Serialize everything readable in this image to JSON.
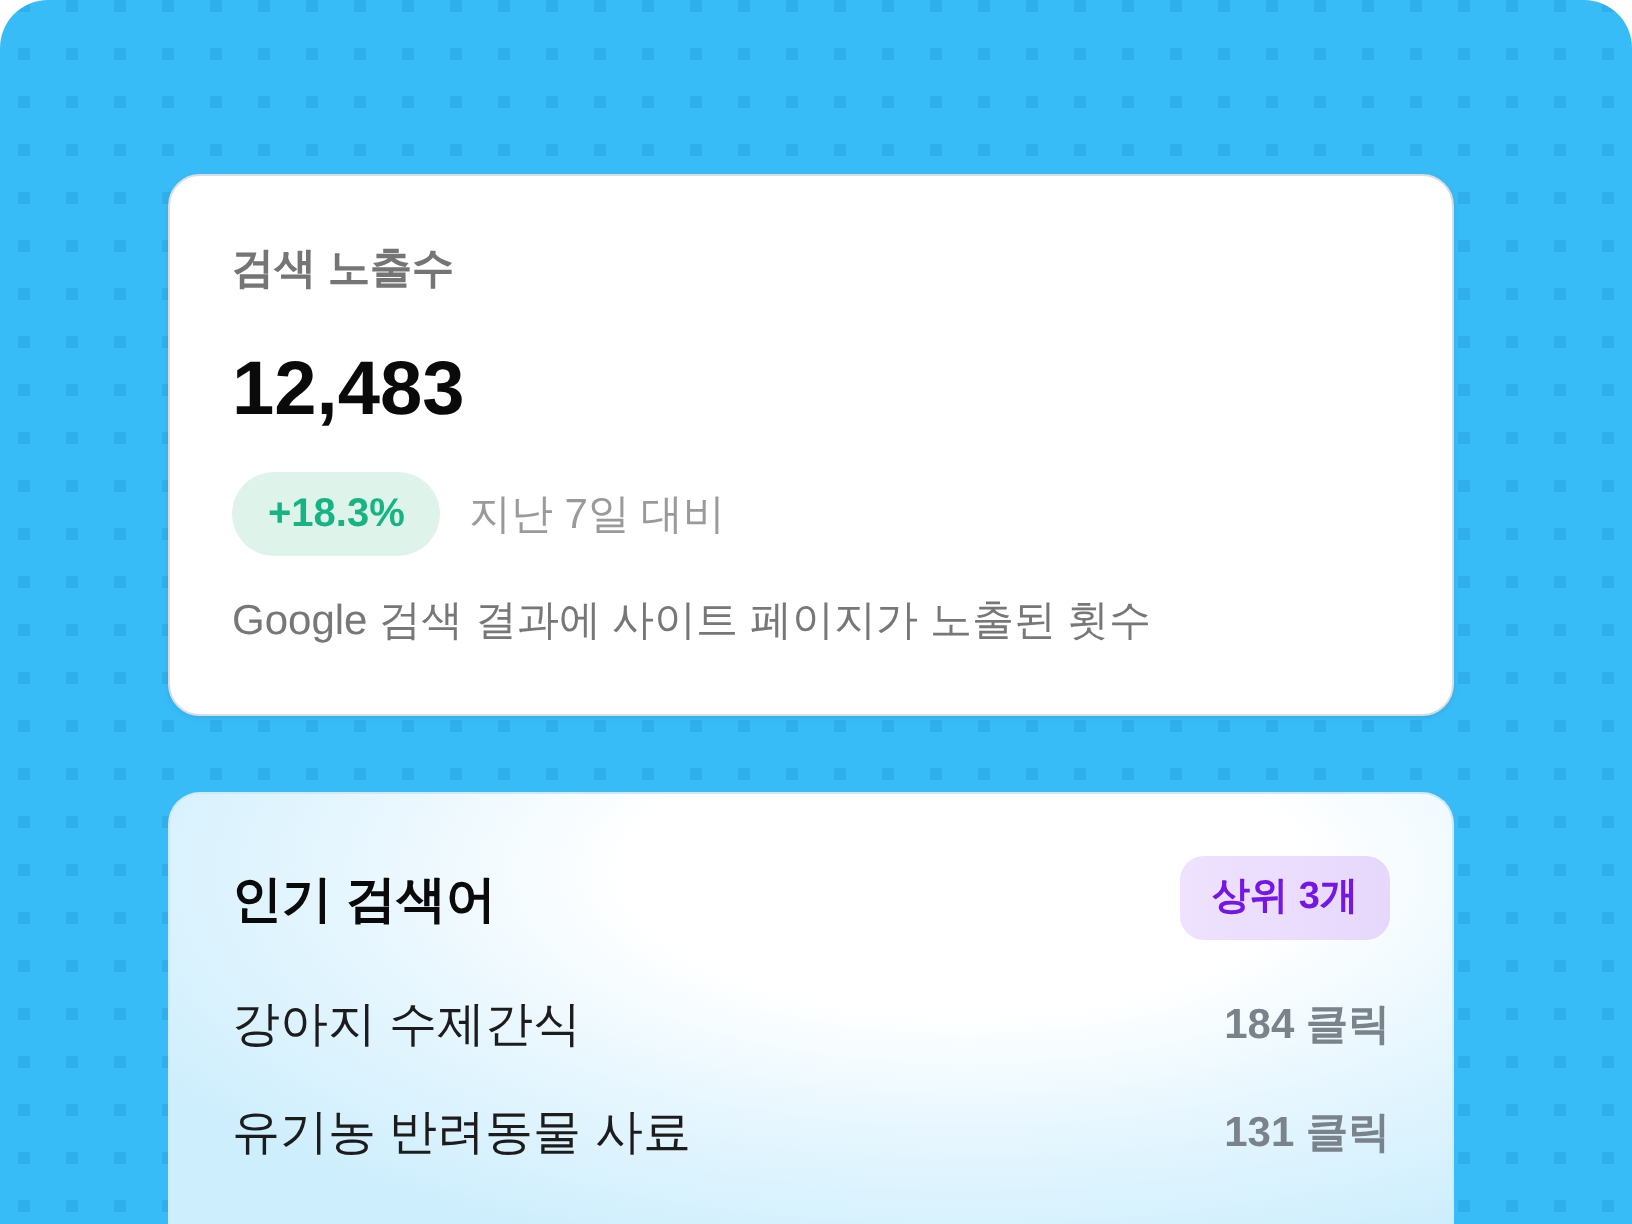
{
  "impressions_card": {
    "title": "검색 노출수",
    "value": "12,483",
    "change": {
      "text": "+18.3%",
      "positive": true
    },
    "comparison": "지난 7일 대비",
    "description": "Google 검색 결과에 사이트 페이지가 노출된 횟수"
  },
  "top_queries_card": {
    "title": "인기 검색어",
    "badge": "상위 3개",
    "rows": [
      {
        "query": "강아지 수제간식",
        "clicks": "184 클릭"
      },
      {
        "query": "유기농 반려동물 사료",
        "clicks": "131 클릭"
      }
    ]
  }
}
